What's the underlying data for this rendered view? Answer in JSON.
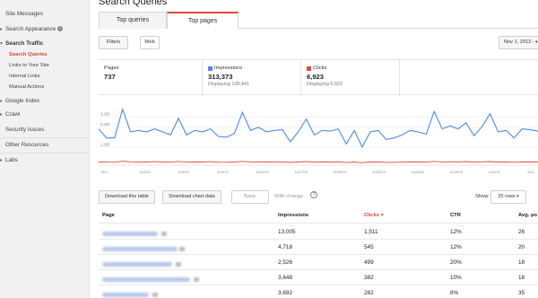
{
  "sidebar": {
    "items": [
      {
        "label": "Site Messages"
      },
      {
        "label": "Search Appearance"
      },
      {
        "label": "Search Traffic"
      },
      {
        "label": "Google Index"
      },
      {
        "label": "Crawl"
      },
      {
        "label": "Security Issues"
      },
      {
        "label": "Other Resources"
      },
      {
        "label": "Labs"
      }
    ],
    "sub_items": [
      {
        "label": "Search Queries"
      },
      {
        "label": "Links to Your Site"
      },
      {
        "label": "Internal Links"
      },
      {
        "label": "Manual Actions"
      }
    ],
    "info_glyph": "i"
  },
  "header": {
    "title": "Search Queries"
  },
  "tabs": [
    {
      "label": "Top queries"
    },
    {
      "label": "Top pages"
    }
  ],
  "toolbar": {
    "filters_label": "Filters",
    "web_label": "Web",
    "date_label": "Nov 1, 2013 -"
  },
  "stats": {
    "pages": {
      "label": "Pages",
      "value": "737"
    },
    "impressions": {
      "label": "Impressions",
      "value": "313,373",
      "sub": "Displaying 108,441",
      "color": "#4a8af4"
    },
    "clicks": {
      "label": "Clicks",
      "value": "6,923",
      "sub": "Displaying 6,923",
      "color": "#dd4b39"
    }
  },
  "chart_data": {
    "type": "line",
    "y_ticks": [
      "3,200",
      "2,530",
      "1,200"
    ],
    "x_ticks": [
      "10/1...",
      "11/3/13",
      "11/6/13",
      "11/9/13",
      "11/13/13",
      "11/17/13",
      "11/20/13",
      "11/23/13",
      "11/26/13",
      "11/29/13",
      "12/3/13",
      "12/1"
    ],
    "ylim": [
      0,
      3800
    ],
    "series": [
      {
        "name": "Impressions",
        "color": "#4a8af4",
        "values": [
          2400,
          1800,
          1800,
          3700,
          2200,
          2300,
          2200,
          2400,
          2200,
          2000,
          3100,
          2000,
          2300,
          2200,
          2400,
          1900,
          1850,
          2100,
          3500,
          2300,
          2500,
          2200,
          2300,
          2350,
          1550,
          2200,
          3050,
          2000,
          2300,
          2250,
          2400,
          1400,
          2300,
          1200,
          2200,
          2300,
          1700,
          1800,
          2000,
          2300,
          2200,
          2050,
          3550,
          2400,
          2600,
          2400,
          2800,
          1950,
          2550,
          3400,
          2200,
          2300,
          1800,
          2400,
          2350,
          2250
        ]
      },
      {
        "name": "Clicks",
        "color": "#dd4b39",
        "values": [
          210,
          200,
          190,
          260,
          220,
          215,
          205,
          230,
          210,
          195,
          250,
          200,
          215,
          210,
          230,
          195,
          190,
          205,
          250,
          215,
          220,
          210,
          215,
          220,
          180,
          205,
          240,
          200,
          210,
          210,
          220,
          170,
          210,
          160,
          205,
          210,
          185,
          190,
          200,
          210,
          205,
          200,
          250,
          215,
          225,
          215,
          235,
          195,
          220,
          240,
          205,
          210,
          190,
          215,
          210,
          205
        ]
      }
    ]
  },
  "actions": {
    "download_table": "Download this table",
    "download_chart": "Download chart data",
    "basic": "Basic",
    "with_change": "With change",
    "help_glyph": "?",
    "show_label": "Show",
    "rows_label": "25 rows"
  },
  "table": {
    "headers": [
      "Page",
      "Impressions",
      "Clicks",
      "CTR",
      "Avg. po"
    ],
    "sort_glyph": "▾",
    "rows": [
      {
        "impressions": "13,005",
        "clicks": "1,511",
        "ctr": "12%",
        "avg": "26"
      },
      {
        "impressions": "4,718",
        "clicks": "545",
        "ctr": "12%",
        "avg": "20"
      },
      {
        "impressions": "2,526",
        "clicks": "499",
        "ctr": "20%",
        "avg": "18"
      },
      {
        "impressions": "3,648",
        "clicks": "382",
        "ctr": "10%",
        "avg": "18"
      },
      {
        "impressions": "3,692",
        "clicks": "282",
        "ctr": "8%",
        "avg": "35"
      }
    ]
  }
}
